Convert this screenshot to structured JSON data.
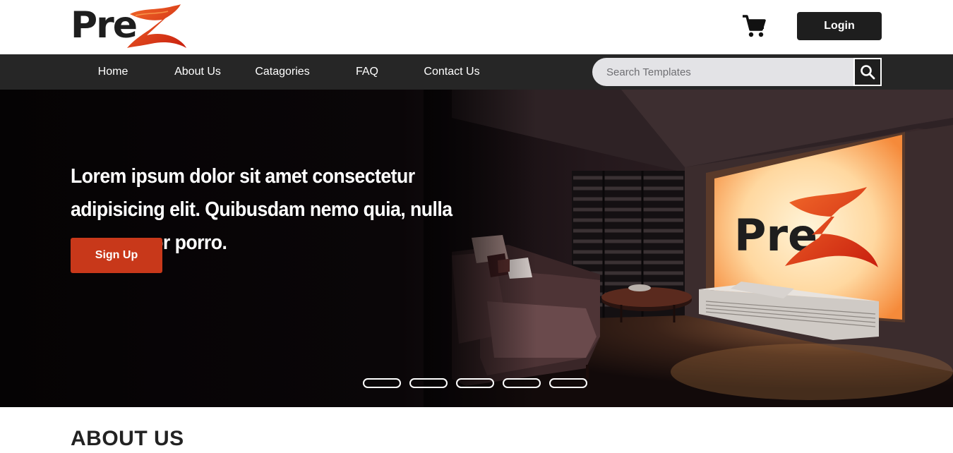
{
  "header": {
    "logo_text": "Pre",
    "logo_accent": "Z",
    "cart_icon": "shopping-cart-icon",
    "login_label": "Login"
  },
  "nav": {
    "items": [
      {
        "label": "Home"
      },
      {
        "label": "About Us"
      },
      {
        "label": "Catagories"
      },
      {
        "label": "FAQ"
      },
      {
        "label": "Contact Us"
      }
    ],
    "search_placeholder": "Search Templates",
    "search_icon": "search-icon"
  },
  "hero": {
    "title": "Lorem ipsum dolor sit amet consectetur adipisicing elit. Quibusdam nemo quia, nulla eaque error porro.",
    "cta_label": "Sign Up",
    "screen_logo_text": "Pre",
    "screen_logo_accent": "Z",
    "slides_count": 5
  },
  "about": {
    "heading": "ABOUT US"
  },
  "colors": {
    "brand_dark": "#1e1e1e",
    "nav_bg": "#262626",
    "accent": "#c8381a",
    "logo_orange": "#e8401c",
    "search_bg": "#e3e3e6"
  }
}
